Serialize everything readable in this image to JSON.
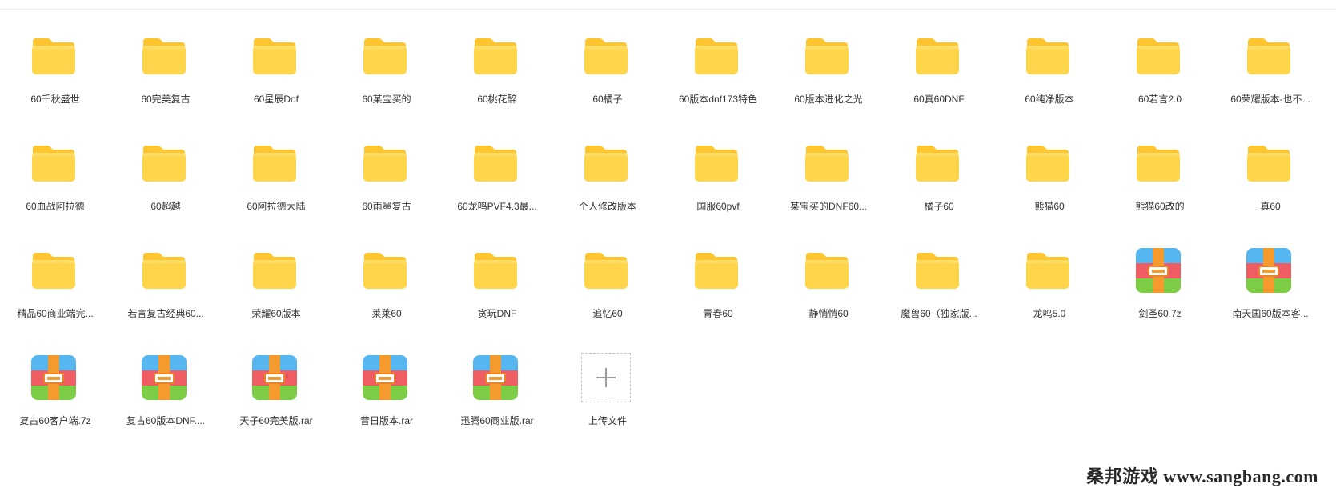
{
  "colors": {
    "folder_back": "#ffc52e",
    "folder_front": "#ffd54b",
    "archive_top": "#56b6ef",
    "archive_mid": "#ef5d63",
    "archive_bottom": "#7ccd45",
    "archive_strap": "#f59a2d"
  },
  "items": [
    {
      "type": "folder",
      "name": "60千秋盛世"
    },
    {
      "type": "folder",
      "name": "60完美复古"
    },
    {
      "type": "folder",
      "name": "60星辰Dof"
    },
    {
      "type": "folder",
      "name": "60某宝买的"
    },
    {
      "type": "folder",
      "name": "60桃花醉"
    },
    {
      "type": "folder",
      "name": "60橘子"
    },
    {
      "type": "folder",
      "name": "60版本dnf173特色"
    },
    {
      "type": "folder",
      "name": "60版本进化之光"
    },
    {
      "type": "folder",
      "name": "60真60DNF"
    },
    {
      "type": "folder",
      "name": "60纯净版本"
    },
    {
      "type": "folder",
      "name": "60若言2.0"
    },
    {
      "type": "folder",
      "name": "60荣耀版本-也不..."
    },
    {
      "type": "folder",
      "name": "60血战阿拉德"
    },
    {
      "type": "folder",
      "name": "60超越"
    },
    {
      "type": "folder",
      "name": "60阿拉德大陆"
    },
    {
      "type": "folder",
      "name": "60雨墨复古"
    },
    {
      "type": "folder",
      "name": "60龙鸣PVF4.3最..."
    },
    {
      "type": "folder",
      "name": "个人修改版本"
    },
    {
      "type": "folder",
      "name": "国服60pvf"
    },
    {
      "type": "folder",
      "name": "某宝买的DNF60..."
    },
    {
      "type": "folder",
      "name": "橘子60"
    },
    {
      "type": "folder",
      "name": "熊猫60"
    },
    {
      "type": "folder",
      "name": "熊猫60改的"
    },
    {
      "type": "folder",
      "name": "真60"
    },
    {
      "type": "folder",
      "name": "精品60商业端完..."
    },
    {
      "type": "folder",
      "name": "若言复古经典60..."
    },
    {
      "type": "folder",
      "name": "荣耀60版本"
    },
    {
      "type": "folder",
      "name": "莱莱60"
    },
    {
      "type": "folder",
      "name": "贪玩DNF"
    },
    {
      "type": "folder",
      "name": "追忆60"
    },
    {
      "type": "folder",
      "name": "青春60"
    },
    {
      "type": "folder",
      "name": "静悄悄60"
    },
    {
      "type": "folder",
      "name": "魔兽60（独家版..."
    },
    {
      "type": "folder",
      "name": "龙鸣5.0"
    },
    {
      "type": "archive",
      "name": "剑圣60.7z"
    },
    {
      "type": "archive",
      "name": "南天国60版本客..."
    },
    {
      "type": "archive",
      "name": "复古60客户端.7z"
    },
    {
      "type": "archive",
      "name": "复古60版本DNF...."
    },
    {
      "type": "archive",
      "name": "天子60完美版.rar"
    },
    {
      "type": "archive",
      "name": "昔日版本.rar"
    },
    {
      "type": "archive",
      "name": "迅腾60商业版.rar"
    },
    {
      "type": "upload",
      "name": "上传文件"
    }
  ],
  "watermark": "桑邦游戏 www.sangbang.com"
}
